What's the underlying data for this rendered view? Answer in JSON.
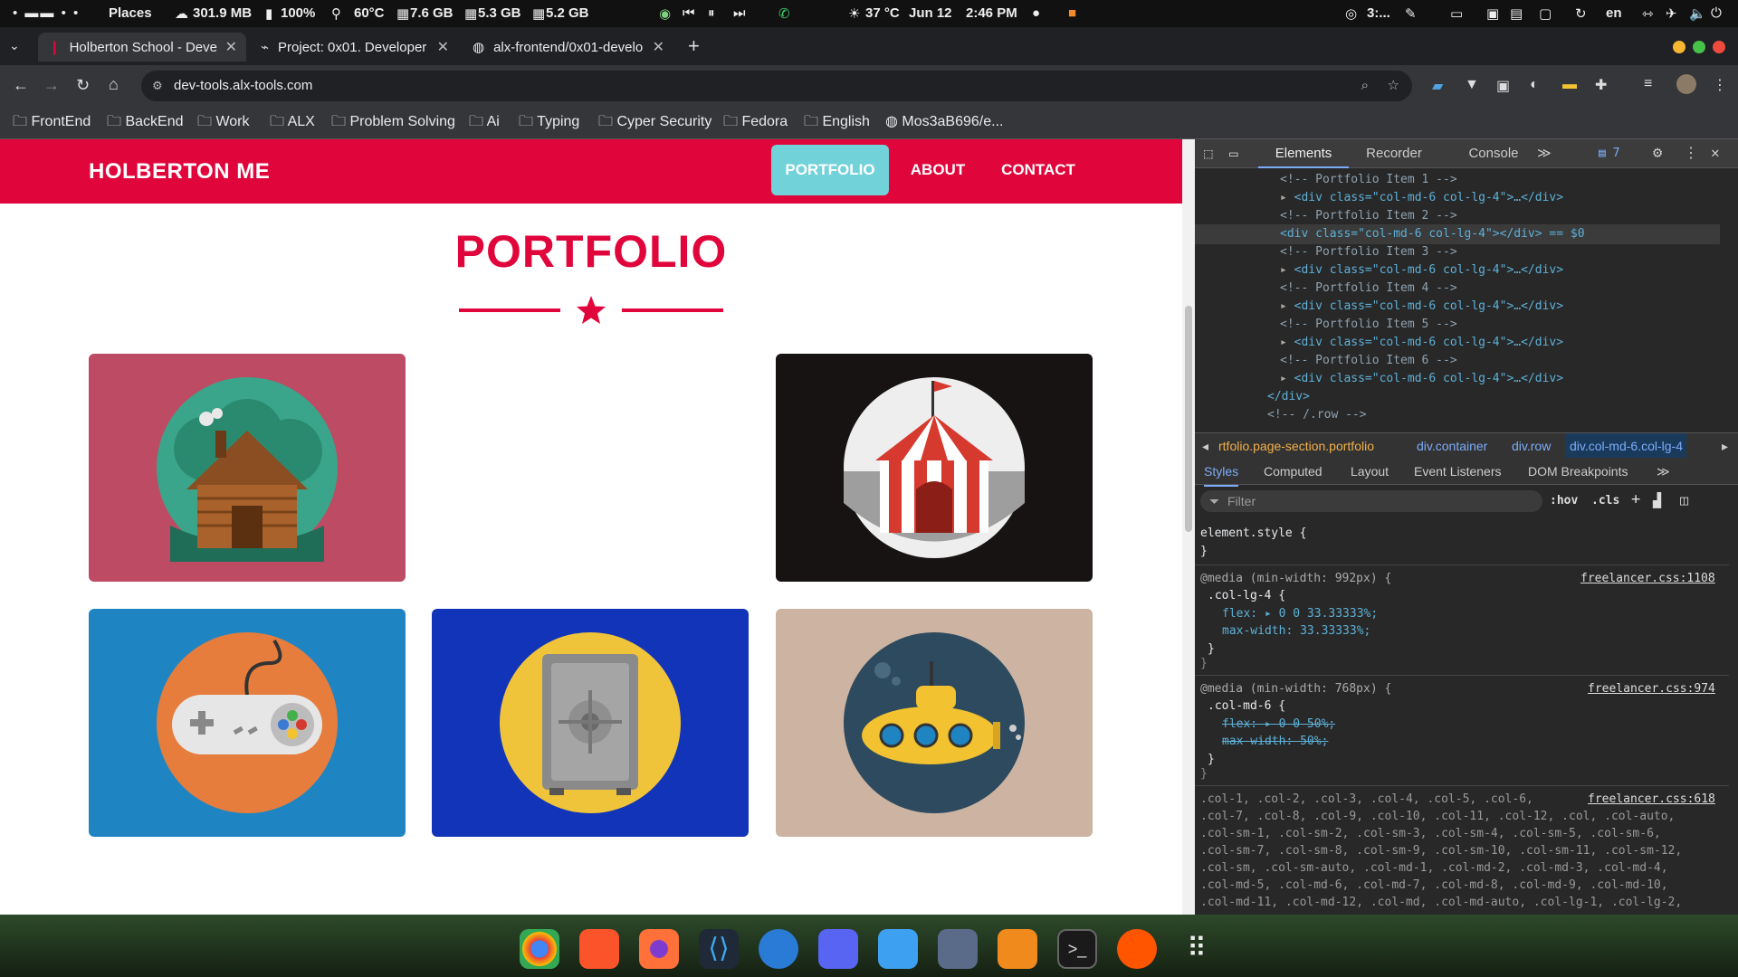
{
  "system_bar": {
    "places": "Places",
    "mem": "301.9 MB",
    "battery": "100%",
    "temp": "60°C",
    "ram": "7.6 GB",
    "swap1": "5.3 GB",
    "swap2": "5.2 GB",
    "weather": "37 °C",
    "date": "Jun 12",
    "time": "2:46 PM",
    "tray_text": "3:...",
    "lang": "en"
  },
  "browser": {
    "tabs": [
      {
        "label": "Holberton School - Deve"
      },
      {
        "label": "Project: 0x01. Developer"
      },
      {
        "label": "alx-frontend/0x01-develo"
      }
    ],
    "url": "dev-tools.alx-tools.com",
    "bookmarks": [
      "FrontEnd",
      "BackEnd",
      "Work",
      "ALX",
      "Problem Solving",
      "Ai",
      "Typing",
      "Cyper Security",
      "Fedora",
      "English",
      "Mos3aB696/e..."
    ]
  },
  "site": {
    "brand": "HOLBERTON ME",
    "nav": [
      "PORTFOLIO",
      "ABOUT",
      "CONTACT"
    ],
    "section_title": "PORTFOLIO",
    "accent": "#e0063c",
    "active_nav_color": "#72d2d9",
    "cards": [
      {
        "name": "cabin",
        "bg": "#bd4b63",
        "visible": true
      },
      {
        "name": "empty",
        "bg": "#ffffff",
        "visible": false
      },
      {
        "name": "circus-tent",
        "bg": "#171312",
        "visible": true
      },
      {
        "name": "game-controller",
        "bg": "#1f85c2",
        "visible": true
      },
      {
        "name": "safe",
        "bg": "#1234b8",
        "visible": true
      },
      {
        "name": "submarine",
        "bg": "#cdb3a1",
        "visible": true
      }
    ]
  },
  "devtools": {
    "tabs": [
      "Elements",
      "Recorder",
      "Console"
    ],
    "badge": "7",
    "dom_lines": [
      "<!-- Portfolio Item 1 -->",
      "<div class=\"col-md-6 col-lg-4\">…</div>",
      "<!-- Portfolio Item 2 -->",
      "<div class=\"col-md-6 col-lg-4\"></div> == $0",
      "<!-- Portfolio Item 3 -->",
      "<div class=\"col-md-6 col-lg-4\">…</div>",
      "<!-- Portfolio Item 4 -->",
      "<div class=\"col-md-6 col-lg-4\">…</div>",
      "<!-- Portfolio Item 5 -->",
      "<div class=\"col-md-6 col-lg-4\">…</div>",
      "<!-- Portfolio Item 6 -->",
      "<div class=\"col-md-6 col-lg-4\">…</div>",
      "</div>",
      "<!-- /.row -->"
    ],
    "breadcrumbs": [
      "rtfolio.page-section.portfolio",
      "div.container",
      "div.row",
      "div.col-md-6.col-lg-4"
    ],
    "style_tabs": [
      "Styles",
      "Computed",
      "Layout",
      "Event Listeners",
      "DOM Breakpoints"
    ],
    "filter_placeholder": "Filter",
    "hov": ":hov",
    "cls": ".cls",
    "element_style": "element.style {",
    "close_brace": "}",
    "media1": "@media (min-width: 992px) {",
    "media1_src": "freelancer.css:1108",
    "rule1_sel": ".col-lg-4 {",
    "rule1_p1": "flex: ▸ 0 0 33.33333%;",
    "rule1_p2": "max-width: 33.33333%;",
    "media2": "@media (min-width: 768px) {",
    "media2_src": "freelancer.css:974",
    "rule2_sel": ".col-md-6 {",
    "rule2_p1": "flex: ▸ 0 0 50%;",
    "rule2_p2": "max-width: 50%;",
    "rule3_src": "freelancer.css:618",
    "rule3_lines": [
      ".col-1, .col-2, .col-3, .col-4, .col-5, .col-6,",
      ".col-7, .col-8, .col-9, .col-10, .col-11, .col-12, .col, .col-auto,",
      ".col-sm-1, .col-sm-2, .col-sm-3, .col-sm-4, .col-sm-5, .col-sm-6,",
      ".col-sm-7, .col-sm-8, .col-sm-9, .col-sm-10, .col-sm-11, .col-sm-12,",
      ".col-sm, .col-sm-auto, .col-md-1, .col-md-2, .col-md-3, .col-md-4,",
      ".col-md-5, .col-md-6, .col-md-7, .col-md-8, .col-md-9, .col-md-10,",
      ".col-md-11, .col-md-12, .col-md, .col-md-auto, .col-lg-1, .col-lg-2,"
    ]
  }
}
